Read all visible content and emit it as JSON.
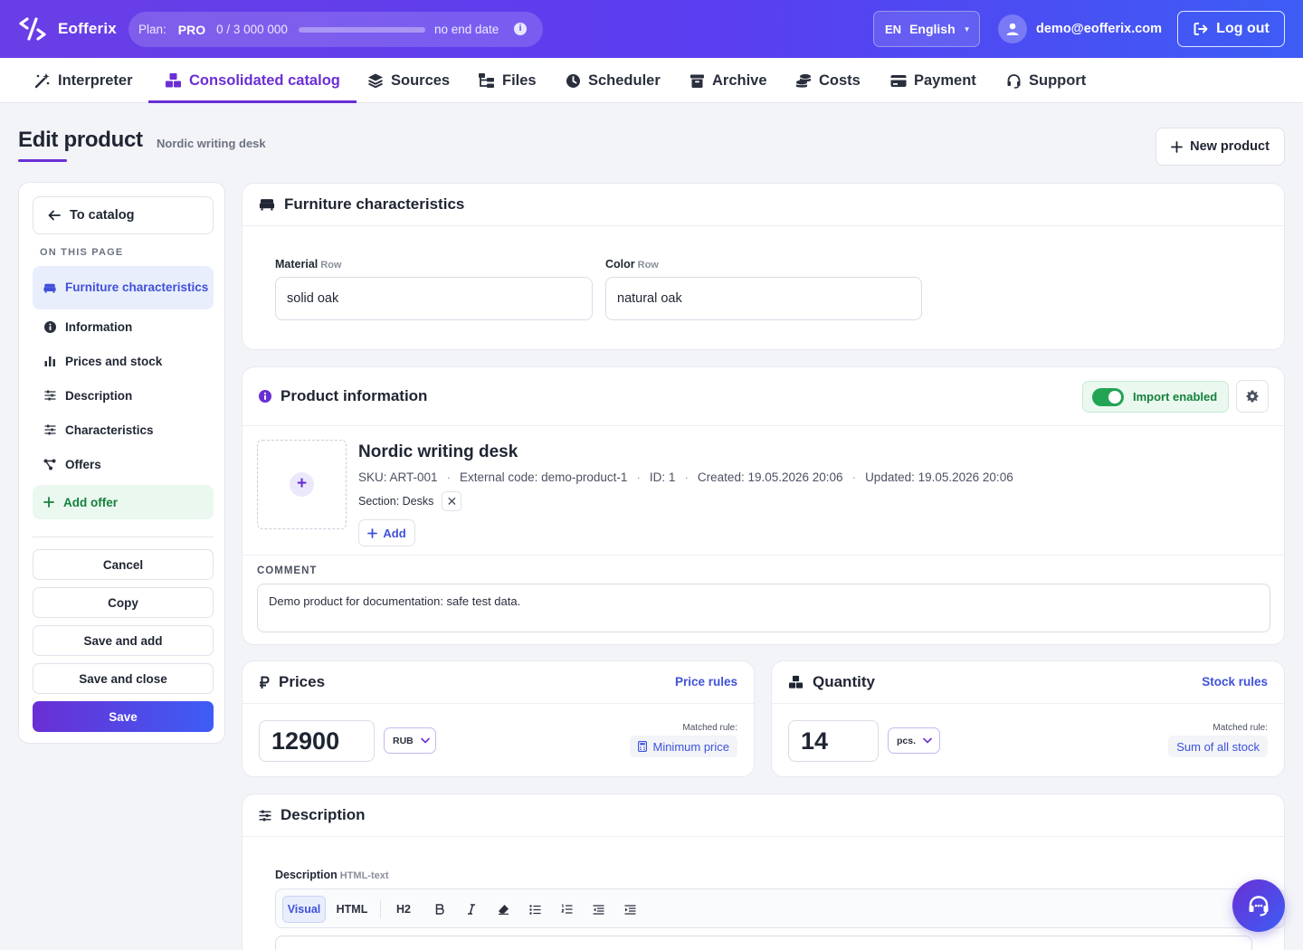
{
  "app": {
    "name": "Eofferix"
  },
  "plan": {
    "label": "Plan:",
    "tier": "PRO",
    "usage_text": "0 / 3 000 000",
    "usage_fraction": 0,
    "end_text": "no end date"
  },
  "language": {
    "code": "EN",
    "name": "English"
  },
  "user": {
    "email": "demo@eofferix.com"
  },
  "header": {
    "logout_label": "Log out"
  },
  "nav": {
    "items": [
      {
        "label": "Interpreter",
        "icon": "magic-wand-icon"
      },
      {
        "label": "Consolidated catalog",
        "icon": "boxes-icon",
        "active": true
      },
      {
        "label": "Sources",
        "icon": "layers-icon"
      },
      {
        "label": "Files",
        "icon": "folder-tree-icon"
      },
      {
        "label": "Scheduler",
        "icon": "clock-icon"
      },
      {
        "label": "Archive",
        "icon": "archive-icon"
      },
      {
        "label": "Costs",
        "icon": "coins-icon"
      },
      {
        "label": "Payment",
        "icon": "credit-card-icon"
      },
      {
        "label": "Support",
        "icon": "headset-icon"
      }
    ]
  },
  "page": {
    "title": "Edit product",
    "subtitle": "Nordic writing desk",
    "new_product_label": "New product"
  },
  "sidebar": {
    "back_label": "To catalog",
    "section_title": "ON THIS PAGE",
    "items": [
      {
        "label": "Furniture characteristics",
        "icon": "sofa-icon",
        "active": true
      },
      {
        "label": "Information",
        "icon": "info-icon"
      },
      {
        "label": "Prices and stock",
        "icon": "bar-chart-icon"
      },
      {
        "label": "Description",
        "icon": "sliders-icon"
      },
      {
        "label": "Characteristics",
        "icon": "sliders-icon"
      },
      {
        "label": "Offers",
        "icon": "share-nodes-icon"
      }
    ],
    "add_offer_label": "Add offer",
    "buttons": {
      "cancel": "Cancel",
      "copy": "Copy",
      "save_and_add": "Save and add",
      "save_and_close": "Save and close",
      "save": "Save"
    }
  },
  "furniture": {
    "title": "Furniture characteristics",
    "material": {
      "label": "Material",
      "tag": "Row",
      "value": "solid oak"
    },
    "color": {
      "label": "Color",
      "tag": "Row",
      "value": "natural oak"
    }
  },
  "product_info": {
    "title": "Product information",
    "import_label": "Import enabled",
    "import_enabled": true,
    "name": "Nordic writing desk",
    "sku": "SKU: ART-001",
    "external_code": "External code: demo-product-1",
    "id": "ID: 1",
    "created": "Created: 19.05.2026 20:06",
    "updated": "Updated: 19.05.2026 20:06",
    "section": "Section: Desks",
    "add_label": "Add",
    "comment_label": "COMMENT",
    "comment": "Demo product for documentation: safe test data."
  },
  "prices": {
    "title": "Prices",
    "rules_link": "Price rules",
    "value": "12900",
    "currency": "RUB",
    "matched_label": "Matched rule:",
    "matched_rule": "Minimum price"
  },
  "quantity": {
    "title": "Quantity",
    "rules_link": "Stock rules",
    "value": "14",
    "unit": "pcs.",
    "matched_label": "Matched rule:",
    "matched_rule": "Sum of all stock"
  },
  "description": {
    "title": "Description",
    "field_label": "Description",
    "field_tag": "HTML-text",
    "toolbar": {
      "visual": "Visual",
      "html": "HTML",
      "h2": "H2"
    }
  },
  "colors": {
    "accent": "#6a2fd4",
    "blue": "#3f51d9",
    "success": "#15803d"
  }
}
